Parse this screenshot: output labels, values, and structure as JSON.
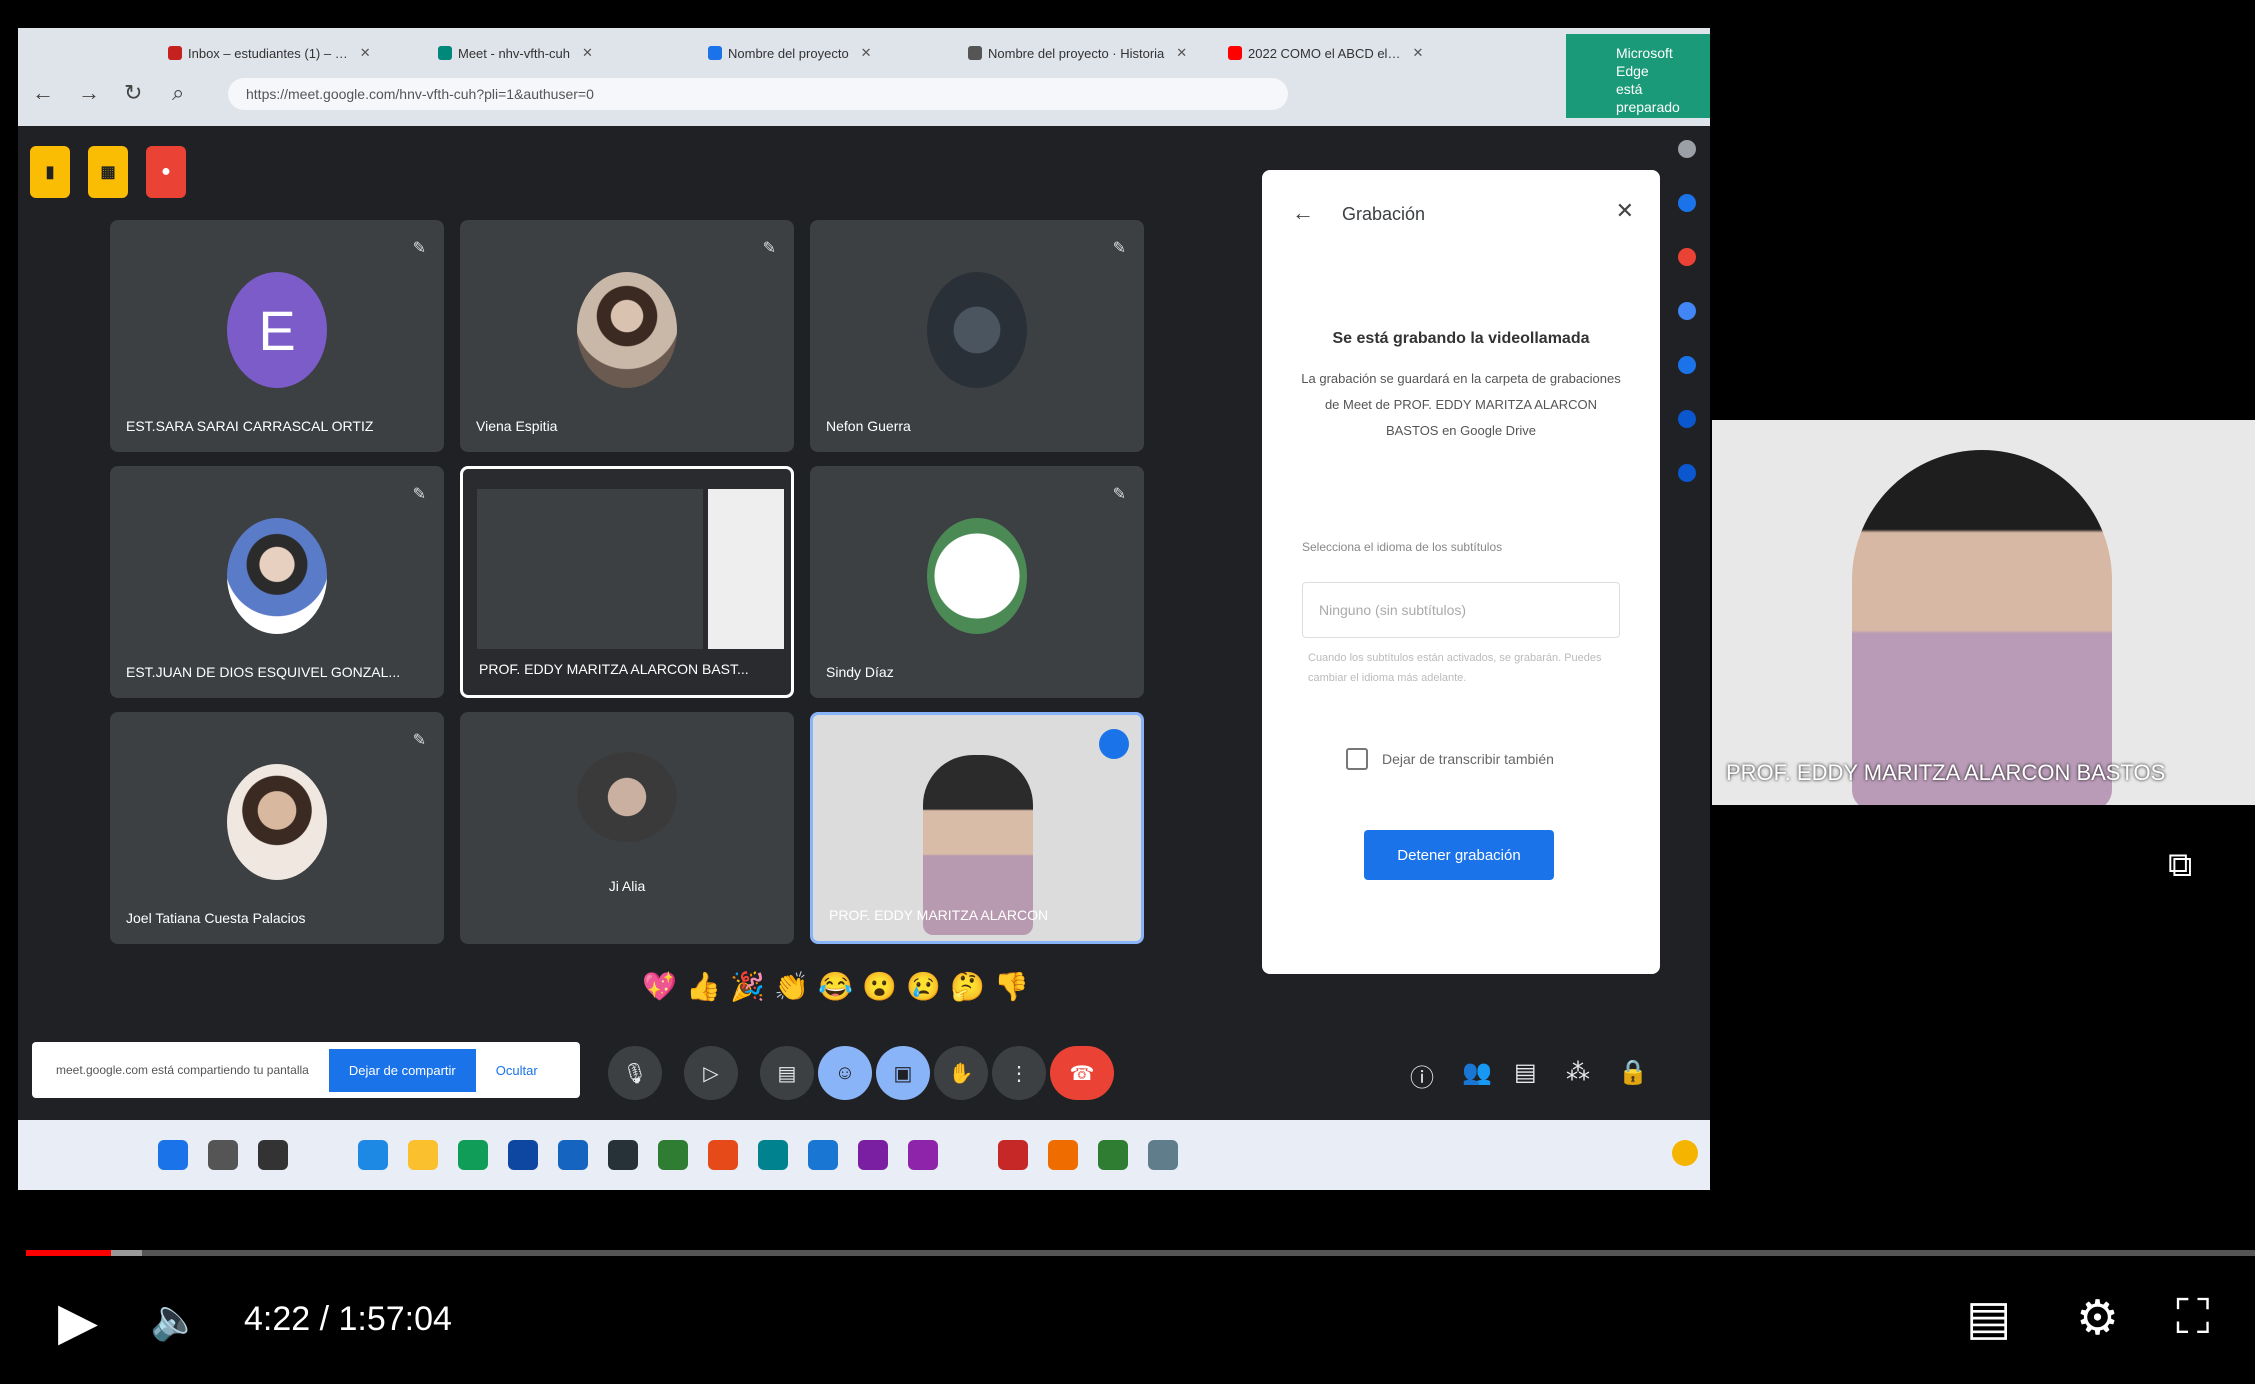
{
  "browser": {
    "tabs": [
      {
        "label": "Inbox – estudiantes (1) – …",
        "color": "#c5221f"
      },
      {
        "label": "Meet - nhv-vfth-cuh",
        "color": "#00897b"
      },
      {
        "label": "Nombre del proyecto",
        "color": "#1a73e8"
      },
      {
        "label": "Nombre del proyecto · Historia",
        "color": "#555555"
      },
      {
        "label": "2022 COMO el ABCD el…",
        "color": "#ff0000"
      }
    ],
    "url": "https://meet.google.com/hnv-vfth-cuh?pli=1&authuser=0",
    "ad_text": "Microsoft Edge",
    "ad_sub": "está preparado"
  },
  "meet": {
    "tiles": [
      {
        "name": "EST.SARA SARAI CARRASCAL ORTIZ",
        "avatar_letter": "E"
      },
      {
        "name": "Viena Espitia",
        "avatar_letter": ""
      },
      {
        "name": "Nefon Guerra",
        "avatar_letter": ""
      },
      {
        "name": "EST.JUAN DE DIOS ESQUIVEL GONZAL...",
        "avatar_letter": ""
      },
      {
        "name": "PROF. EDDY MARITZA ALARCON BAST...",
        "avatar_letter": ""
      },
      {
        "name": "Sindy Díaz",
        "avatar_letter": ""
      },
      {
        "name": "Joel Tatiana Cuesta Palacios",
        "avatar_letter": ""
      },
      {
        "name": "Ji Alia",
        "avatar_letter": ""
      },
      {
        "name": "PROF. EDDY MARITZA ALARCON",
        "avatar_letter": ""
      }
    ],
    "panel": {
      "title": "Grabación",
      "heading": "Se está grabando la videollamada",
      "body": "La grabación se guardará en la carpeta de grabaciones de Meet de PROF. EDDY MARITZA ALARCON BASTOS en Google Drive",
      "sublabel": "Selecciona el idioma de los subtítulos",
      "select_value": "Ninguno (sin subtítulos)",
      "faint": "Cuando los subtítulos están activados, se grabarán. Puedes cambiar el idioma más adelante.",
      "checkbox_label": "Dejar de transcribir también",
      "stop_button": "Detener grabación"
    },
    "reactions": [
      "💖",
      "👍",
      "🎉",
      "👏",
      "😂",
      "😮",
      "😢",
      "🤔",
      "👎"
    ],
    "share_bar": {
      "text": "meet.google.com está compartiendo tu pantalla",
      "stop_label": "Dejar de compartir",
      "hide_label": "Ocultar"
    }
  },
  "presenter": {
    "name": "PROF. EDDY MARITZA ALARCON BASTOS"
  },
  "player": {
    "time": "4:22 / 1:57:04",
    "progress_played": 0.038,
    "progress_loaded": 0.052
  },
  "colors": {
    "accent": "#1a73e8",
    "progress": "#ff0000"
  }
}
